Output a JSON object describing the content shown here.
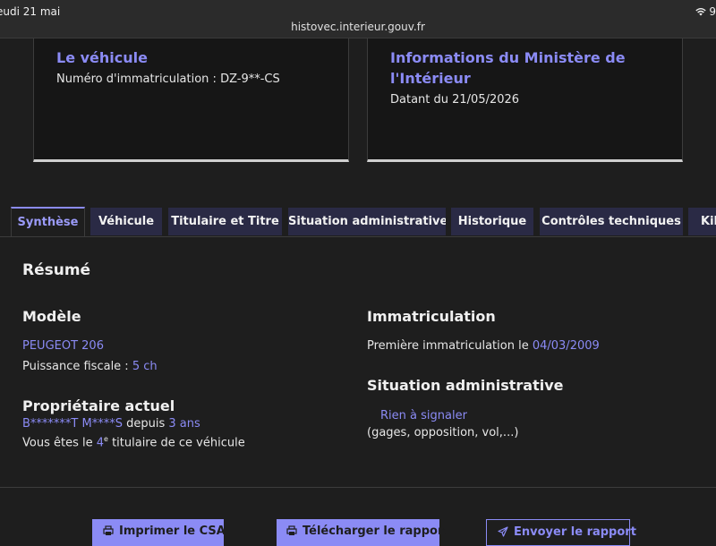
{
  "status_bar": {
    "date": "eudi 21 mai",
    "battery": "9",
    "url": "histovec.interieur.gouv.fr"
  },
  "vehicle_card": {
    "title": "Le véhicule",
    "plate_text": "Numéro d'immatriculation : DZ-9**-CS"
  },
  "ministry_card": {
    "title_line1": "Informations du Ministère de",
    "title_line2": "l'Intérieur",
    "date_text": "Datant du 21/05/2026"
  },
  "tabs": [
    {
      "label": "Synthèse"
    },
    {
      "label": "Véhicule"
    },
    {
      "label": "Titulaire et Titre"
    },
    {
      "label": "Situation administrative"
    },
    {
      "label": "Historique"
    },
    {
      "label": "Contrôles techniques"
    },
    {
      "label": "Kilo"
    }
  ],
  "summary": {
    "heading": "Résumé",
    "model": {
      "heading": "Modèle",
      "name": "PEUGEOT 206",
      "power_label": "Puissance fiscale : ",
      "power_value": "5 ch"
    },
    "owner": {
      "heading": "Propriétaire actuel",
      "name": "B*******T M****S",
      "since_label": " depuis ",
      "since_value": "3 ans",
      "rank_prefix": "Vous êtes le ",
      "rank_value": "4",
      "rank_sup": "e",
      "rank_suffix": " titulaire de ce véhicule"
    },
    "registration": {
      "heading": "Immatriculation",
      "label": "Première immatriculation le ",
      "date": "04/03/2009"
    },
    "admin": {
      "heading": "Situation administrative",
      "status": "Rien à signaler",
      "details": "(gages, opposition, vol,...)"
    }
  },
  "actions": {
    "print_label": "Imprimer le CSA",
    "download_label": "Télécharger le rapport",
    "send_label": "Envoyer le rapport"
  },
  "colors": {
    "accent": "#8b8bf5",
    "background": "#1e1e1e",
    "tab_background": "#2a2a45"
  }
}
